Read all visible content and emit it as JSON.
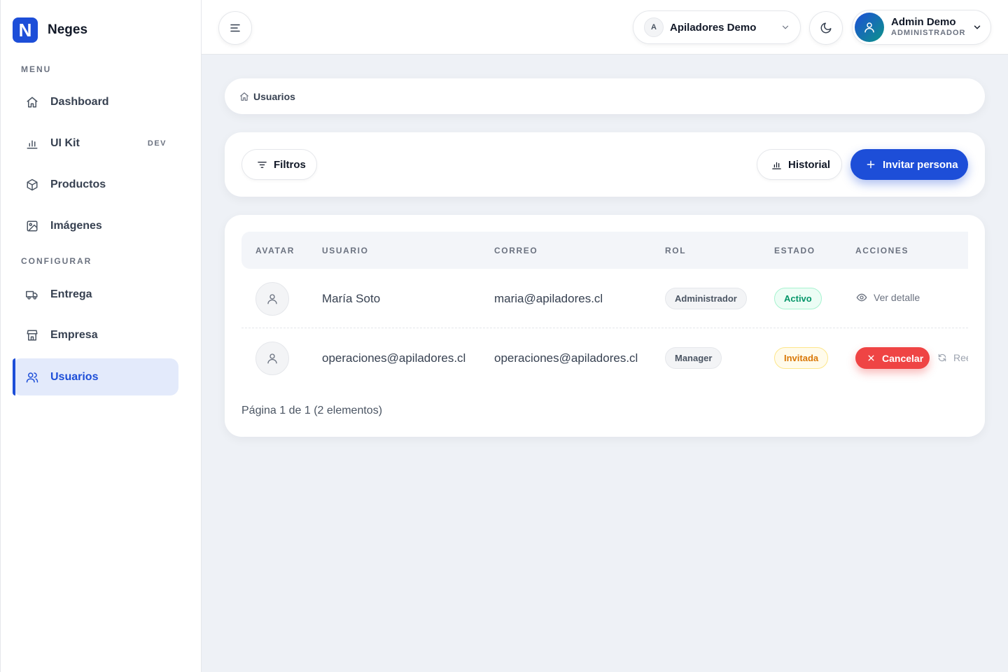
{
  "brand": {
    "logo_letter": "N",
    "name": "Neges"
  },
  "sidebar": {
    "sections": [
      {
        "label": "MENU"
      },
      {
        "label": "CONFIGURAR"
      }
    ],
    "items": [
      {
        "label": "Dashboard",
        "icon": "home-icon"
      },
      {
        "label": "UI Kit",
        "icon": "chart-icon",
        "badge": "DEV"
      },
      {
        "label": "Productos",
        "icon": "box-icon"
      },
      {
        "label": "Imágenes",
        "icon": "image-icon"
      },
      {
        "label": "Entrega",
        "icon": "truck-icon"
      },
      {
        "label": "Empresa",
        "icon": "store-icon"
      },
      {
        "label": "Usuarios",
        "icon": "users-icon",
        "active": true
      }
    ]
  },
  "header": {
    "company": {
      "initial": "A",
      "name": "Apiladores Demo"
    },
    "user": {
      "name": "Admin Demo",
      "role": "ADMINISTRADOR"
    }
  },
  "breadcrumb": {
    "current": "Usuarios"
  },
  "toolbar": {
    "filters_label": "Filtros",
    "history_label": "Historial",
    "invite_label": "Invitar persona"
  },
  "table": {
    "columns": [
      "AVATAR",
      "USUARIO",
      "CORREO",
      "ROL",
      "ESTADO",
      "ACCIONES"
    ],
    "rows": [
      {
        "user": "María Soto",
        "email": "maria@apiladores.cl",
        "role": "Administrador",
        "status": "Activo",
        "action": "Ver detalle"
      },
      {
        "user": "operaciones@apiladores.cl",
        "email": "operaciones@apiladores.cl",
        "role": "Manager",
        "status": "Invitada",
        "action_cancel": "Cancelar",
        "action_resend": "Ree"
      }
    ],
    "pagination": "Página 1 de 1 (2 elementos)"
  },
  "colors": {
    "accent": "#1d4ed8",
    "danger": "#ef4444",
    "success": "#059669",
    "warning": "#d97706"
  }
}
